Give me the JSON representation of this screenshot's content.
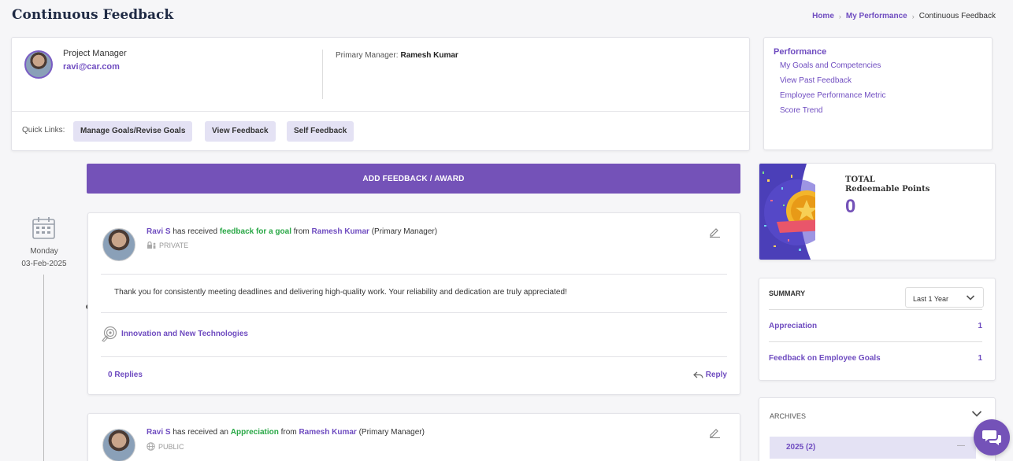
{
  "page": {
    "title": "Continuous Feedback"
  },
  "breadcrumb": {
    "home": "Home",
    "parent": "My Performance",
    "current": "Continuous Feedback"
  },
  "profile": {
    "role": "Project Manager",
    "email": "ravi@car.com",
    "primary_manager_label": "Primary Manager:",
    "primary_manager_name": "Ramesh Kumar"
  },
  "quick_links": {
    "label": "Quick Links:",
    "items": [
      "Manage Goals/Revise Goals",
      "View Feedback",
      "Self Feedback"
    ]
  },
  "side_links": {
    "heading": "Performance",
    "items": [
      "My Goals and Competencies",
      "View Past Feedback",
      "Employee Performance Metric",
      "Score Trend"
    ]
  },
  "add_button": "ADD FEEDBACK / AWARD",
  "timeline": {
    "day": "Monday",
    "date": "03-Feb-2025"
  },
  "feedback": [
    {
      "recipient": "Ravi S",
      "verb": "has received",
      "kind": "feedback for a goal",
      "from_word": "from",
      "from": "Ramesh Kumar",
      "role": "(Primary Manager)",
      "visibility": "PRIVATE",
      "message": "Thank you for consistently meeting deadlines and delivering high-quality work. Your reliability and dedication are truly appreciated!",
      "competency": "Innovation and New Technologies",
      "replies": "0 Replies",
      "reply_label": "Reply"
    },
    {
      "recipient": "Ravi S",
      "verb": "has received an",
      "kind": "Appreciation",
      "from_word": "from",
      "from": "Ramesh Kumar",
      "role": "(Primary Manager)",
      "visibility": "PUBLIC"
    }
  ],
  "points": {
    "label_line1": "TOTAL",
    "label_line2": "Redeemable Points",
    "value": "0"
  },
  "summary": {
    "heading": "SUMMARY",
    "period": "Last 1 Year",
    "rows": [
      {
        "label": "Appreciation",
        "count": "1"
      },
      {
        "label": "Feedback on Employee Goals",
        "count": "1"
      }
    ]
  },
  "archives": {
    "heading": "ARCHIVES",
    "year": "2025 (2)",
    "collapse": "—"
  },
  "colors": {
    "accent": "#7452b8",
    "link": "#6f4cc0",
    "green": "#28a745",
    "chip": "#e4e2f4"
  }
}
